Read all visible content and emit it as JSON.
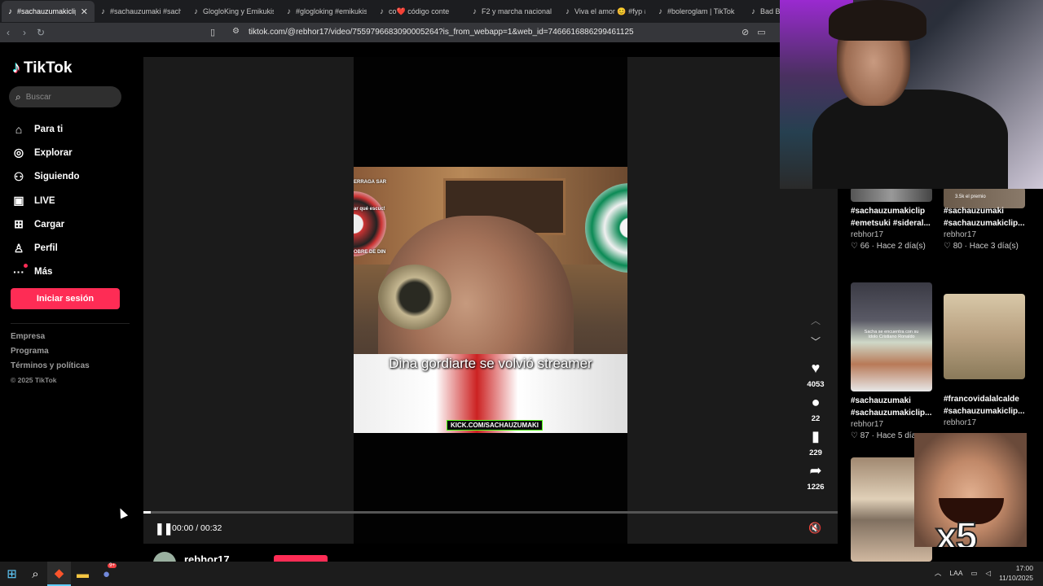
{
  "browser": {
    "tabs": [
      {
        "label": "#sachauzumakiclip",
        "active": true
      },
      {
        "label": "#sachauzumaki #sacha"
      },
      {
        "label": "GlogloKing y Emikukis"
      },
      {
        "label": "#glogloking #emikukis"
      },
      {
        "label": "co❤️ código conte"
      },
      {
        "label": "F2 y marcha nacional p"
      },
      {
        "label": "Viva el amor 😊 #fyp #"
      },
      {
        "label": "#boleroglam | TikTok"
      },
      {
        "label": "Bad B"
      }
    ],
    "url": "tiktok.com/@rebhor17/video/7559796683090005264?is_from_webapp=1&web_id=7466616886299461125"
  },
  "sidebar": {
    "logo": "TikTok",
    "search_placeholder": "Buscar",
    "items": [
      {
        "label": "Para ti",
        "icon": "home-icon"
      },
      {
        "label": "Explorar",
        "icon": "compass-icon"
      },
      {
        "label": "Siguiendo",
        "icon": "following-icon"
      },
      {
        "label": "LIVE",
        "icon": "live-icon"
      },
      {
        "label": "Cargar",
        "icon": "upload-icon"
      },
      {
        "label": "Perfil",
        "icon": "profile-icon"
      },
      {
        "label": "Más",
        "icon": "more-icon"
      }
    ],
    "login": "Iniciar sesión",
    "footer": [
      "Empresa",
      "Programa",
      "Términos y políticas"
    ],
    "copyright": "© 2025 TikTok"
  },
  "video": {
    "caption": "Dina gordiarte se volvió streamer",
    "watermark": "KICK.COM/SACHAUZUMAKI",
    "side_texts": [
      "ERRAGA SAR",
      "ar qué escuc!",
      "OBRE DE DIN"
    ],
    "time": "00:00 / 00:32",
    "progress": 0.01,
    "likes": "4053",
    "comments": "22",
    "saves": "229",
    "shares": "1226",
    "author": "rebhor17"
  },
  "grid": [
    {
      "tags": [
        "#sachauzumakiclip",
        "#emetsuki #sideral..."
      ],
      "author": "rebhor17",
      "likes": "66",
      "age": "Hace 2 día(s)"
    },
    {
      "tags": [
        "#sachauzumaki",
        "#sachauzumakiclip..."
      ],
      "author": "rebhor17",
      "likes": "80",
      "age": "Hace 3 día(s)"
    },
    {
      "tags": [
        "#sachauzumaki",
        "#sachauzumakiclip..."
      ],
      "author": "rebhor17",
      "likes": "87",
      "age": "Hace 5 día"
    },
    {
      "tags": [
        "#francovidalalcalde",
        "#sachauzumakiclip..."
      ],
      "author": "rebhor17",
      "likes": "",
      "age": ""
    }
  ],
  "thumb_texts": [
    "3.5k el premio",
    "Sacha se encuentra con su ídolo Cristiano Ronaldo"
  ],
  "overlay": {
    "meme_text": "x5"
  },
  "taskbar": {
    "time": "17:00",
    "date": "11/10/2025",
    "lang": "LAA",
    "discord_badge": "9+"
  }
}
